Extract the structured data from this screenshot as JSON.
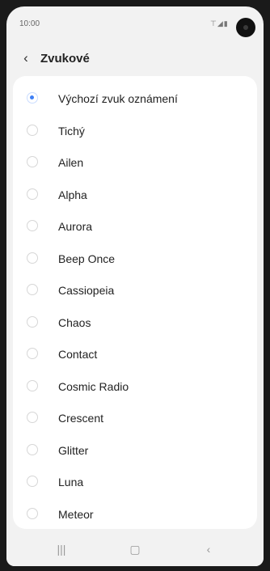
{
  "status_bar": {
    "time": "10:00",
    "indicators": "⊤◢▮"
  },
  "header": {
    "back_icon": "‹",
    "title": "Zvukové"
  },
  "sounds": [
    {
      "label": "Výchozí zvuk oznámení",
      "selected": true
    },
    {
      "label": "Tichý",
      "selected": false
    },
    {
      "label": "Ailen",
      "selected": false
    },
    {
      "label": "Alpha",
      "selected": false
    },
    {
      "label": "Aurora",
      "selected": false
    },
    {
      "label": "Beep Once",
      "selected": false
    },
    {
      "label": "Cassiopeia",
      "selected": false
    },
    {
      "label": "Chaos",
      "selected": false
    },
    {
      "label": "Contact",
      "selected": false
    },
    {
      "label": "Cosmic Radio",
      "selected": false
    },
    {
      "label": "Crescent",
      "selected": false
    },
    {
      "label": "Glitter",
      "selected": false
    },
    {
      "label": "Luna",
      "selected": false
    },
    {
      "label": "Meteor",
      "selected": false
    }
  ],
  "nav_bar": {
    "recents_icon": "|||",
    "home_icon": "▢",
    "back_icon": "‹"
  },
  "colors": {
    "accent": "#3e7ff5",
    "background": "#f2f2f2",
    "card": "#ffffff"
  }
}
